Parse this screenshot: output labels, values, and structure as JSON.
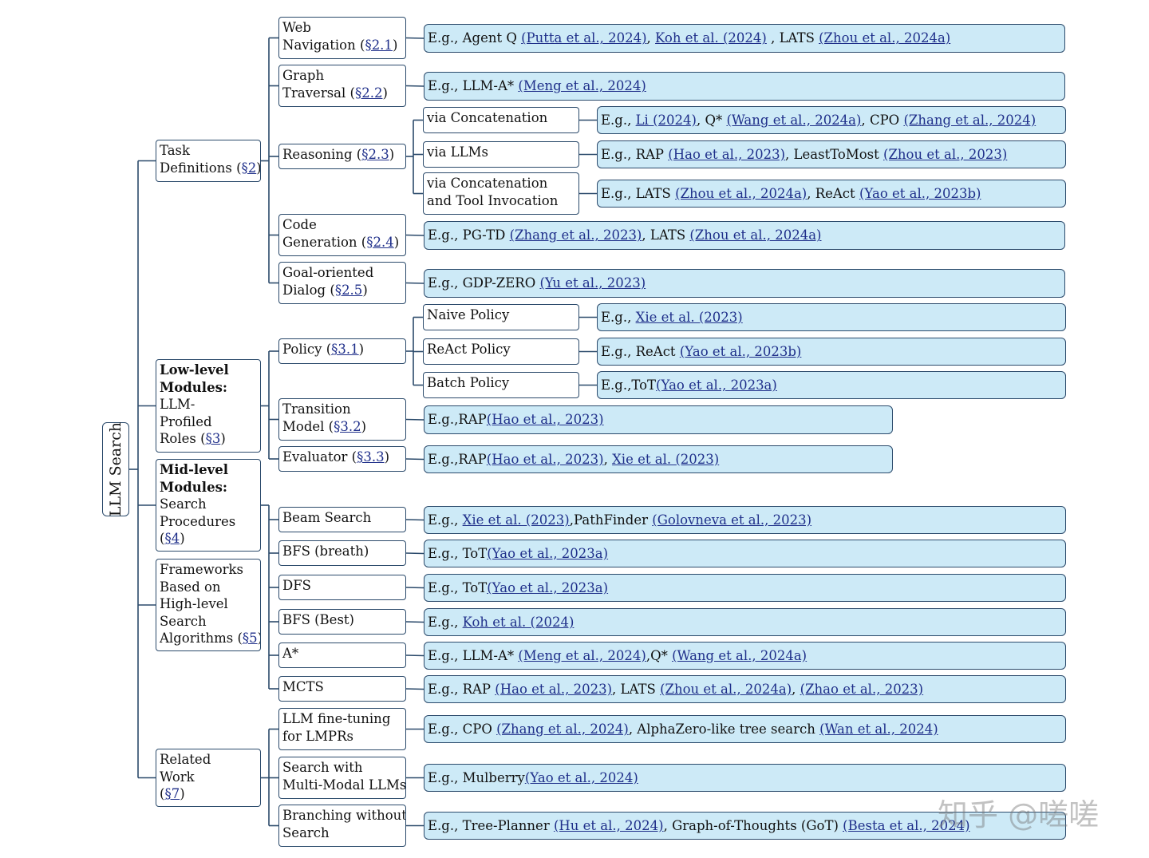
{
  "root": {
    "label": "LLM Search"
  },
  "categories": [
    {
      "id": "task",
      "lines": [
        [
          {
            "t": "Task"
          }
        ],
        [
          {
            "t": "Definitions "
          },
          {
            "t": "(",
            "n": 1
          },
          {
            "t": "§2",
            "link": true
          },
          {
            "t": ")"
          }
        ]
      ]
    },
    {
      "id": "low",
      "lines": [
        [
          {
            "t": "Low-level",
            "b": true
          }
        ],
        [
          {
            "t": "Modules:",
            "b": true
          }
        ],
        [
          {
            "t": "LLM-"
          }
        ],
        [
          {
            "t": "Profiled"
          }
        ],
        [
          {
            "t": "Roles ("
          },
          {
            "t": "§3",
            "link": true
          },
          {
            "t": ")"
          }
        ]
      ]
    },
    {
      "id": "mid",
      "lines": [
        [
          {
            "t": "Mid-level",
            "b": true
          }
        ],
        [
          {
            "t": "Modules:",
            "b": true
          }
        ],
        [
          {
            "t": "Search"
          }
        ],
        [
          {
            "t": "Procedures"
          }
        ],
        [
          {
            "t": "("
          },
          {
            "t": "§4",
            "link": true
          },
          {
            "t": ")"
          }
        ]
      ]
    },
    {
      "id": "frame",
      "lines": [
        [
          {
            "t": "Frameworks"
          }
        ],
        [
          {
            "t": "Based on"
          }
        ],
        [
          {
            "t": "High-level"
          }
        ],
        [
          {
            "t": "Search"
          }
        ],
        [
          {
            "t": "Algorithms ("
          },
          {
            "t": "§5",
            "link": true
          },
          {
            "t": ")"
          }
        ]
      ]
    },
    {
      "id": "related",
      "lines": [
        [
          {
            "t": "Related"
          }
        ],
        [
          {
            "t": "Work"
          }
        ],
        [
          {
            "t": "("
          },
          {
            "t": "§7",
            "link": true
          },
          {
            "t": ")"
          }
        ]
      ]
    }
  ],
  "level2": [
    {
      "id": "web",
      "lines": [
        [
          {
            "t": "Web"
          }
        ],
        [
          {
            "t": "Navigation ("
          },
          {
            "t": "§2.1",
            "link": true
          },
          {
            "t": ")"
          }
        ]
      ]
    },
    {
      "id": "graph",
      "lines": [
        [
          {
            "t": "Graph"
          }
        ],
        [
          {
            "t": "Traversal ("
          },
          {
            "t": "§2.2",
            "link": true
          },
          {
            "t": ")"
          }
        ]
      ]
    },
    {
      "id": "reason",
      "lines": [
        [
          {
            "t": "Reasoning ("
          },
          {
            "t": "§2.3",
            "link": true
          },
          {
            "t": ")"
          }
        ]
      ]
    },
    {
      "id": "code",
      "lines": [
        [
          {
            "t": "Code"
          }
        ],
        [
          {
            "t": "Generation ("
          },
          {
            "t": "§2.4",
            "link": true
          },
          {
            "t": ")"
          }
        ]
      ]
    },
    {
      "id": "goal",
      "lines": [
        [
          {
            "t": "Goal-oriented"
          }
        ],
        [
          {
            "t": "Dialog ("
          },
          {
            "t": "§2.5",
            "link": true
          },
          {
            "t": ")"
          }
        ]
      ]
    },
    {
      "id": "policy",
      "lines": [
        [
          {
            "t": "Policy ("
          },
          {
            "t": "§3.1",
            "link": true
          },
          {
            "t": ")"
          }
        ]
      ]
    },
    {
      "id": "trans",
      "lines": [
        [
          {
            "t": "Transition"
          }
        ],
        [
          {
            "t": "Model ("
          },
          {
            "t": "§3.2",
            "link": true
          },
          {
            "t": ")"
          }
        ]
      ]
    },
    {
      "id": "eval",
      "lines": [
        [
          {
            "t": "Evaluator ("
          },
          {
            "t": "§3.3",
            "link": true
          },
          {
            "t": ")"
          }
        ]
      ]
    },
    {
      "id": "beam",
      "lines": [
        [
          {
            "t": "Beam Search"
          }
        ]
      ]
    },
    {
      "id": "bfsb",
      "lines": [
        [
          {
            "t": "BFS (breath)"
          }
        ]
      ]
    },
    {
      "id": "dfs",
      "lines": [
        [
          {
            "t": "DFS"
          }
        ]
      ]
    },
    {
      "id": "bfsbest",
      "lines": [
        [
          {
            "t": "BFS (Best)"
          }
        ]
      ]
    },
    {
      "id": "astar",
      "lines": [
        [
          {
            "t": "A*"
          }
        ]
      ]
    },
    {
      "id": "mcts",
      "lines": [
        [
          {
            "t": "MCTS"
          }
        ]
      ]
    },
    {
      "id": "finetune",
      "lines": [
        [
          {
            "t": "LLM fine-tuning"
          }
        ],
        [
          {
            "t": "for LMPRs"
          }
        ]
      ]
    },
    {
      "id": "multimodal",
      "lines": [
        [
          {
            "t": "Search with"
          }
        ],
        [
          {
            "t": "Multi-Modal LLMs"
          }
        ]
      ]
    },
    {
      "id": "branching",
      "lines": [
        [
          {
            "t": "Branching without"
          }
        ],
        [
          {
            "t": "Search"
          }
        ]
      ]
    }
  ],
  "level3": [
    {
      "id": "concat",
      "lines": [
        [
          {
            "t": "via Concatenation"
          }
        ]
      ]
    },
    {
      "id": "vllm",
      "lines": [
        [
          {
            "t": "via LLMs"
          }
        ]
      ]
    },
    {
      "id": "concattool",
      "lines": [
        [
          {
            "t": "via Concatenation"
          }
        ],
        [
          {
            "t": "and Tool Invocation"
          }
        ]
      ]
    },
    {
      "id": "naive",
      "lines": [
        [
          {
            "t": "Naive Policy"
          }
        ]
      ]
    },
    {
      "id": "react",
      "lines": [
        [
          {
            "t": "ReAct Policy"
          }
        ]
      ]
    },
    {
      "id": "batch",
      "lines": [
        [
          {
            "t": "Batch Policy"
          }
        ]
      ]
    }
  ],
  "leaves": [
    {
      "id": "l-web",
      "parts": [
        {
          "t": "E.g.,   Agent Q "
        },
        {
          "t": "(Putta et al., 2024)",
          "link": true
        },
        {
          "t": ", "
        },
        {
          "t": "Koh et al. (2024)",
          "link": true
        },
        {
          "t": " , LATS "
        },
        {
          "t": "(Zhou et al., 2024a)",
          "link": true
        }
      ]
    },
    {
      "id": "l-graph",
      "parts": [
        {
          "t": "E.g.,   LLM-A* "
        },
        {
          "t": "(Meng et al., 2024)",
          "link": true
        }
      ]
    },
    {
      "id": "l-concat",
      "parts": [
        {
          "t": "E.g.,   "
        },
        {
          "t": "Li (2024)",
          "link": true
        },
        {
          "t": ", Q* "
        },
        {
          "t": "(Wang et al., 2024a)",
          "link": true
        },
        {
          "t": ", CPO "
        },
        {
          "t": "(Zhang et al., 2024)",
          "link": true
        }
      ]
    },
    {
      "id": "l-vllm",
      "parts": [
        {
          "t": "E.g.,   RAP "
        },
        {
          "t": "(Hao et al., 2023)",
          "link": true
        },
        {
          "t": ", LeastToMost  "
        },
        {
          "t": "(Zhou et al., 2023)",
          "link": true
        }
      ]
    },
    {
      "id": "l-concattool",
      "parts": [
        {
          "t": "E.g.,   LATS "
        },
        {
          "t": "(Zhou et al., 2024a)",
          "link": true
        },
        {
          "t": ", ReAct "
        },
        {
          "t": "(Yao et al., 2023b)",
          "link": true
        }
      ]
    },
    {
      "id": "l-code",
      "parts": [
        {
          "t": "E.g.,   PG-TD "
        },
        {
          "t": "(Zhang et al., 2023)",
          "link": true
        },
        {
          "t": ", LATS "
        },
        {
          "t": "(Zhou et al., 2024a)",
          "link": true
        }
      ]
    },
    {
      "id": "l-goal",
      "parts": [
        {
          "t": "E.g.,    GDP-ZERO "
        },
        {
          "t": "(Yu et al., 2023)",
          "link": true
        }
      ]
    },
    {
      "id": "l-naive",
      "parts": [
        {
          "t": "E.g.,   "
        },
        {
          "t": "Xie et al. (2023)",
          "link": true
        }
      ]
    },
    {
      "id": "l-react",
      "parts": [
        {
          "t": "E.g.,   ReAct "
        },
        {
          "t": "(Yao et al., 2023b)",
          "link": true
        }
      ]
    },
    {
      "id": "l-batch",
      "parts": [
        {
          "t": "E.g.,ToT"
        },
        {
          "t": "(Yao et al., 2023a)",
          "link": true
        }
      ]
    },
    {
      "id": "l-trans",
      "parts": [
        {
          "t": "E.g.,RAP"
        },
        {
          "t": "(Hao et al., 2023)",
          "link": true
        }
      ]
    },
    {
      "id": "l-eval",
      "parts": [
        {
          "t": "E.g.,RAP"
        },
        {
          "t": "(Hao et al., 2023)",
          "link": true
        },
        {
          "t": ", "
        },
        {
          "t": "Xie et al. (2023)",
          "link": true
        }
      ]
    },
    {
      "id": "l-beam",
      "parts": [
        {
          "t": "E.g., "
        },
        {
          "t": "Xie et al. (2023)",
          "link": true
        },
        {
          "t": ",PathFinder "
        },
        {
          "t": "(Golovneva et al., 2023)",
          "link": true
        }
      ]
    },
    {
      "id": "l-bfsb",
      "parts": [
        {
          "t": "E.g., ToT"
        },
        {
          "t": "(Yao et al., 2023a)",
          "link": true
        }
      ]
    },
    {
      "id": "l-dfs",
      "parts": [
        {
          "t": "E.g., ToT"
        },
        {
          "t": "(Yao et al., 2023a)",
          "link": true
        }
      ]
    },
    {
      "id": "l-bfsbest",
      "parts": [
        {
          "t": "E.g., "
        },
        {
          "t": "Koh et al. (2024)",
          "link": true
        }
      ]
    },
    {
      "id": "l-astar",
      "parts": [
        {
          "t": "E.g., LLM-A* "
        },
        {
          "t": "(Meng et al., 2024)",
          "link": true
        },
        {
          "t": ",Q* "
        },
        {
          "t": "(Wang et al., 2024a)",
          "link": true
        }
      ]
    },
    {
      "id": "l-mcts",
      "parts": [
        {
          "t": "E.g.,   RAP "
        },
        {
          "t": "(Hao et al., 2023)",
          "link": true
        },
        {
          "t": ", LATS "
        },
        {
          "t": "(Zhou et al., 2024a)",
          "link": true
        },
        {
          "t": ", "
        },
        {
          "t": "(Zhao et al., 2023)",
          "link": true
        }
      ]
    },
    {
      "id": "l-finetune",
      "parts": [
        {
          "t": "E.g.,   CPO "
        },
        {
          "t": "(Zhang et al., 2024)",
          "link": true
        },
        {
          "t": ", AlphaZero-like tree search "
        },
        {
          "t": "(Wan et al., 2024)",
          "link": true
        }
      ]
    },
    {
      "id": "l-multimodal",
      "parts": [
        {
          "t": "E.g.,   Mulberry"
        },
        {
          "t": "(Yao et al., 2024)",
          "link": true
        }
      ]
    },
    {
      "id": "l-branching",
      "parts": [
        {
          "t": "E.g.,   Tree-Planner "
        },
        {
          "t": "(Hu et al., 2024)",
          "link": true
        },
        {
          "t": ", Graph-of-Thoughts (GoT) "
        },
        {
          "t": "(Besta et al., 2024)",
          "link": true
        }
      ]
    }
  ],
  "watermark": "知乎 @嗟嗟",
  "colors": {
    "border": "#2b4a6b",
    "leaf_fill": "#cdeaf7",
    "link": "#1f2f8a",
    "line": "#2b4a6b"
  }
}
